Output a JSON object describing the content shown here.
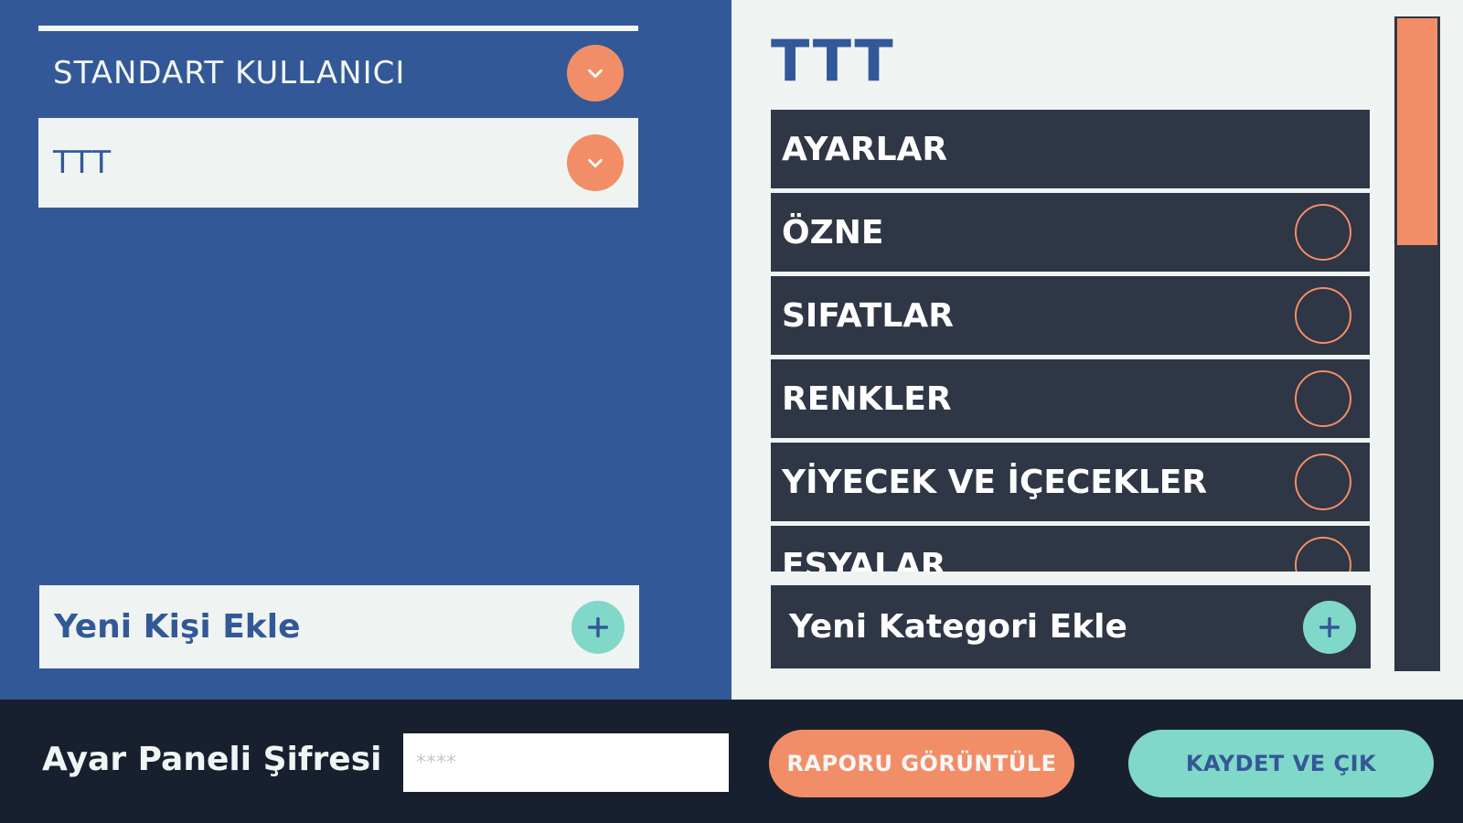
{
  "users": {
    "standard_label": "STANDART KULLANICI",
    "selected_label": "TTT"
  },
  "add_person_label": "Yeni Kişi Ekle",
  "detail": {
    "title": "TTT",
    "categories": [
      {
        "label": "AYARLAR",
        "has_toggle": false
      },
      {
        "label": "ÖZNE",
        "has_toggle": true
      },
      {
        "label": "SIFATLAR",
        "has_toggle": true
      },
      {
        "label": "RENKLER",
        "has_toggle": true
      },
      {
        "label": "YİYECEK VE İÇECEKLER",
        "has_toggle": true
      },
      {
        "label": "EŞYALAR",
        "has_toggle": true
      }
    ],
    "add_category_label": "Yeni Kategori Ekle"
  },
  "footer": {
    "password_label": "Ayar Paneli Şifresi",
    "password_value": "****",
    "report_button": "RAPORU GÖRÜNTÜLE",
    "save_button": "KAYDET VE ÇIK"
  },
  "colors": {
    "primary_blue": "#335897",
    "accent_orange": "#f28e67",
    "accent_teal": "#80d8c9",
    "dark_row": "#2f3645",
    "light_bg": "#eff4f2"
  },
  "icons": {
    "dropdown": "chevron-down-icon",
    "add": "plus-icon",
    "toggle": "radio-circle-icon"
  }
}
